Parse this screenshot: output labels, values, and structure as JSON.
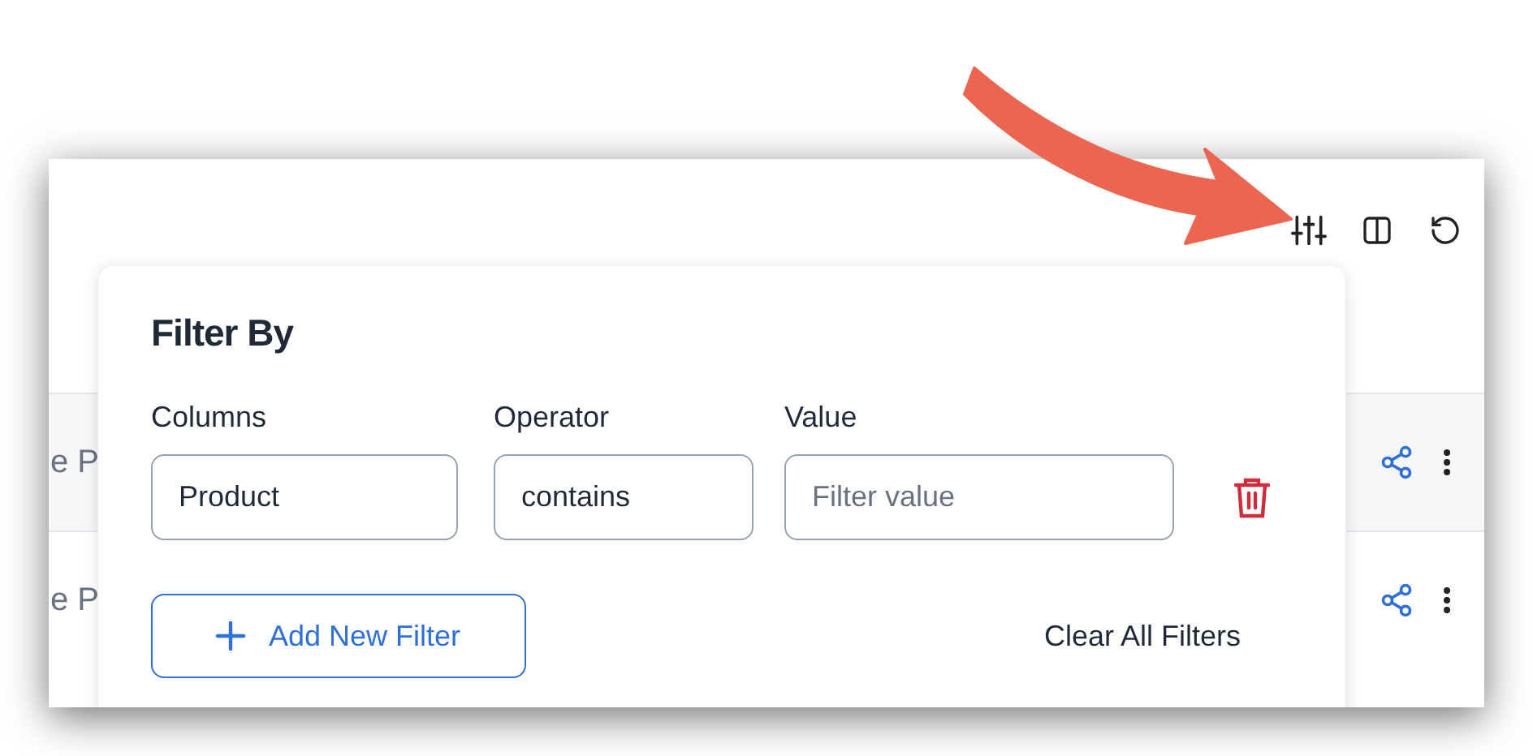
{
  "rows": [
    {
      "cell_text": "e P"
    },
    {
      "cell_text": "e P"
    }
  ],
  "filter_panel": {
    "title": "Filter By",
    "columns_label": "Columns",
    "operator_label": "Operator",
    "value_label": "Value",
    "column_value": "Product",
    "operator_value": "contains",
    "value_placeholder": "Filter value",
    "add_button": "Add New Filter",
    "clear_button": "Clear All Filters"
  }
}
